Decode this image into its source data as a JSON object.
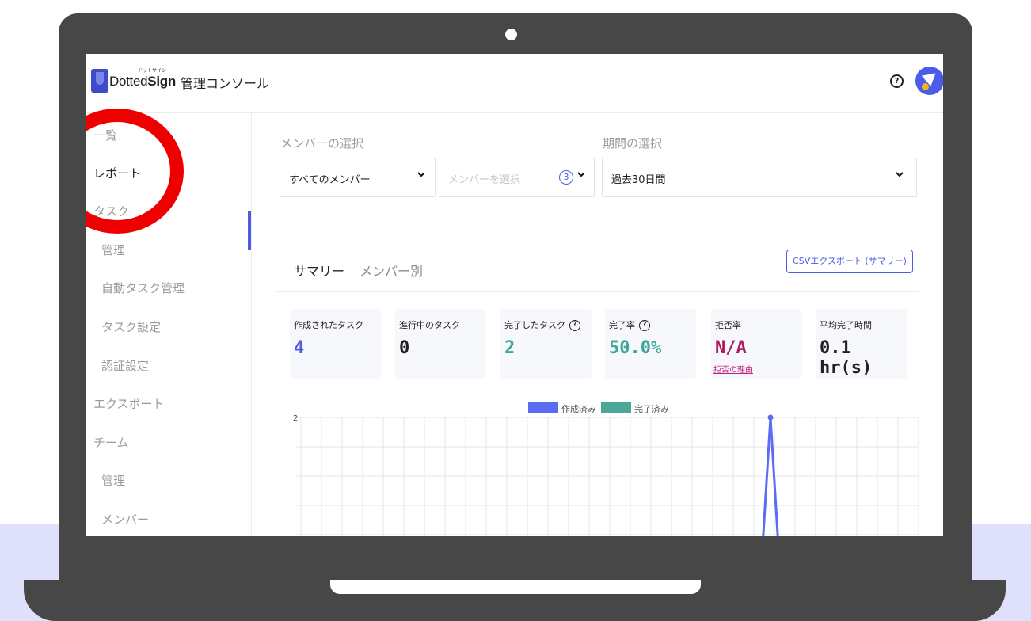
{
  "header": {
    "logo_kana": "ドットサイン",
    "logo_text_light": "Dotted",
    "logo_text_bold": "Sign",
    "title": "管理コンソール",
    "help_glyph": "?"
  },
  "sidebar": {
    "items": [
      {
        "label": "一覧"
      },
      {
        "label": "レポート"
      },
      {
        "label": "タスク"
      },
      {
        "label": "管理"
      },
      {
        "label": "自動タスク管理"
      },
      {
        "label": "タスク設定"
      },
      {
        "label": "認証設定"
      },
      {
        "label": "エクスポート"
      },
      {
        "label": "チーム"
      },
      {
        "label": "管理"
      },
      {
        "label": "メンバー"
      }
    ]
  },
  "filters": {
    "member_label": "メンバーの選択",
    "member_scope_value": "すべてのメンバー",
    "member_picker_placeholder": "メンバーを選択",
    "member_count": "3",
    "period_label": "期間の選択",
    "period_value": "過去30日間"
  },
  "tabs": {
    "summary": "サマリー",
    "by_member": "メンバー別",
    "csv_export": "CSVエクスポート (サマリー)"
  },
  "stats": {
    "created": {
      "label": "作成されたタスク",
      "value": "4"
    },
    "in_progress": {
      "label": "進行中のタスク",
      "value": "0"
    },
    "completed": {
      "label": "完了したタスク",
      "value": "2"
    },
    "completion_rate": {
      "label": "完了率",
      "value": "50.0%"
    },
    "rejection_rate": {
      "label": "拒否率",
      "value": "N/A",
      "link": "拒否の理由"
    },
    "avg_time": {
      "label": "平均完了時間",
      "value": "0.1 hr(s)"
    }
  },
  "colors": {
    "accent": "#4d5ce0",
    "teal": "#3fa89a",
    "magenta": "#b0195f",
    "red_annotation": "#ee0000"
  },
  "chart_data": {
    "type": "line",
    "series": [
      {
        "name": "作成済み",
        "color": "#5b6cf0"
      },
      {
        "name": "完了済み",
        "color": "#4ba898"
      }
    ],
    "y_tick_top": "2",
    "ylim_top": 2,
    "peak_value": 2,
    "grid": true,
    "legend": "top-center"
  }
}
